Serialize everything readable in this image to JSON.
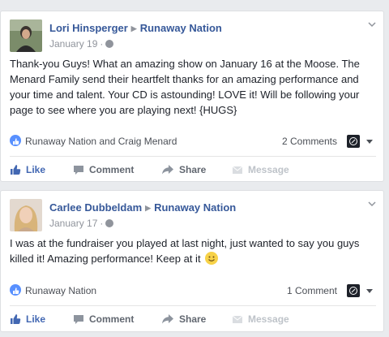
{
  "posts": [
    {
      "author": "Lori Hinsperger",
      "page": "Runaway Nation",
      "date": "January 19",
      "text": "Thank-you Guys! What an amazing show on January 16 at the Moose. The Menard Family send their heartfelt thanks for an amazing performance and your time and talent. Your CD is astounding! LOVE it! Will be following your page to see where you are playing next! {HUGS}",
      "likers": "Runaway Nation and Craig Menard",
      "comments": "2 Comments"
    },
    {
      "author": "Carlee Dubbeldam",
      "page": "Runaway Nation",
      "date": "January 17",
      "text": "I was at the fundraiser you played at last night, just wanted to say you guys killed it! Amazing performance! Keep at it",
      "likers": "Runaway Nation",
      "comments": "1 Comment"
    }
  ],
  "actions": {
    "like": "Like",
    "comment": "Comment",
    "share": "Share",
    "message": "Message"
  },
  "separators": {
    "dot": "·"
  },
  "icons": {
    "arrow": "triangle-right-icon",
    "privacy": "globe-icon",
    "menu": "chevron-down-icon",
    "like_badge": "thumbs-up-icon",
    "emoji": "smiley-icon"
  },
  "colors": {
    "link": "#365899",
    "accent": "#4267b2",
    "muted": "#90949c",
    "background": "#e9ebee"
  }
}
